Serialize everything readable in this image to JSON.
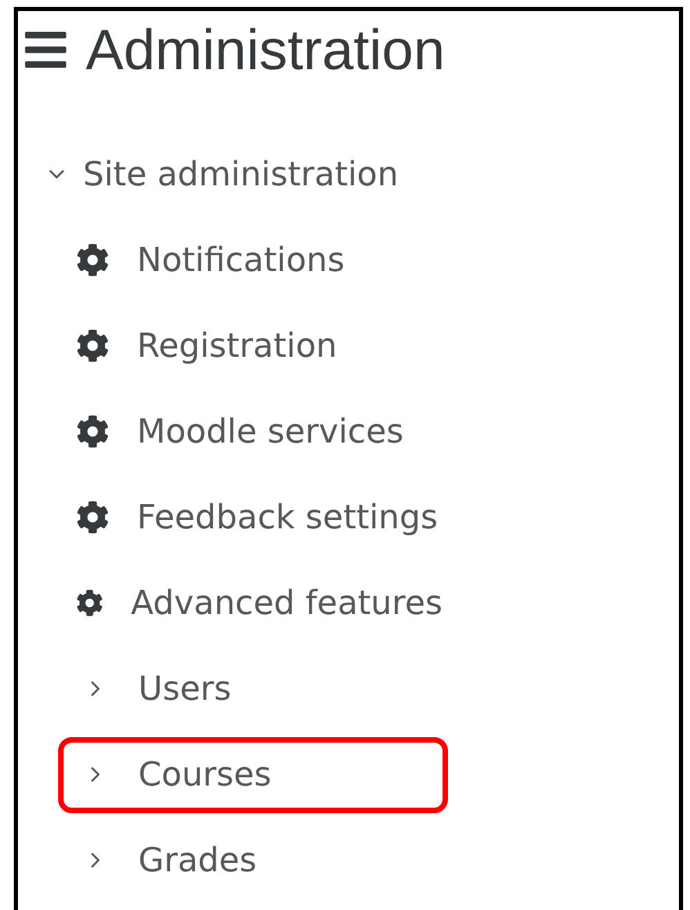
{
  "header": {
    "title": "Administration"
  },
  "tree": {
    "label": "Site administration",
    "expanded": true,
    "children": [
      {
        "kind": "setting",
        "label": "Notifications",
        "highlighted": false
      },
      {
        "kind": "setting",
        "label": "Registration",
        "highlighted": false
      },
      {
        "kind": "setting",
        "label": "Moodle services",
        "highlighted": false
      },
      {
        "kind": "setting",
        "label": "Feedback settings",
        "highlighted": false
      },
      {
        "kind": "setting",
        "label": "Advanced features",
        "highlighted": false
      },
      {
        "kind": "category",
        "label": "Users",
        "expanded": false,
        "highlighted": false
      },
      {
        "kind": "category",
        "label": "Courses",
        "expanded": false,
        "highlighted": true
      },
      {
        "kind": "category",
        "label": "Grades",
        "expanded": false,
        "highlighted": false
      }
    ]
  }
}
